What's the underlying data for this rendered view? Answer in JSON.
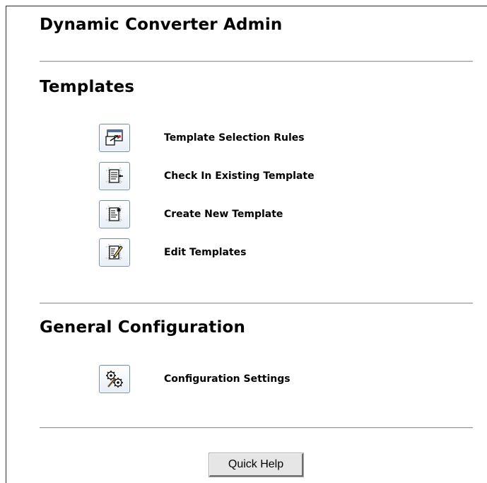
{
  "page": {
    "title": "Dynamic Converter Admin"
  },
  "templates_section": {
    "title": "Templates",
    "items": [
      {
        "label": "Template Selection Rules",
        "icon": "template-selection-icon"
      },
      {
        "label": "Check In Existing Template",
        "icon": "check-in-template-icon"
      },
      {
        "label": "Create New Template",
        "icon": "create-template-icon"
      },
      {
        "label": "Edit Templates",
        "icon": "edit-templates-icon"
      }
    ]
  },
  "general_section": {
    "title": "General Configuration",
    "items": [
      {
        "label": "Configuration Settings",
        "icon": "configuration-settings-icon"
      }
    ]
  },
  "footer": {
    "quick_help_label": "Quick Help"
  },
  "colors": {
    "icon_border": "#6f8fb8",
    "rule": "#9a9a9a",
    "button_face": "#e6e6e6"
  }
}
